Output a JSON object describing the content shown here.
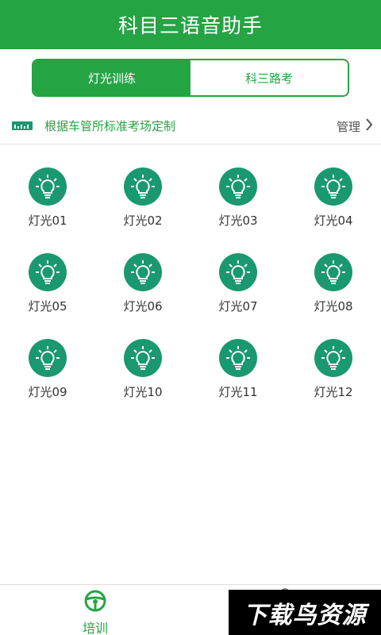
{
  "header": {
    "title": "科目三语音助手"
  },
  "tabs": [
    {
      "label": "灯光训练",
      "active": true
    },
    {
      "label": "科三路考",
      "active": false
    }
  ],
  "notice": {
    "icon": "ruler-icon",
    "text": "根据车管所标准考场定制",
    "manage_label": "管理"
  },
  "lights": [
    {
      "label": "灯光01"
    },
    {
      "label": "灯光02"
    },
    {
      "label": "灯光03"
    },
    {
      "label": "灯光04"
    },
    {
      "label": "灯光05"
    },
    {
      "label": "灯光06"
    },
    {
      "label": "灯光07"
    },
    {
      "label": "灯光08"
    },
    {
      "label": "灯光09"
    },
    {
      "label": "灯光10"
    },
    {
      "label": "灯光11"
    },
    {
      "label": "灯光12"
    }
  ],
  "bottom_nav": {
    "items": [
      {
        "label": "培训",
        "icon": "steering-wheel-icon",
        "active": true
      }
    ]
  },
  "watermark": {
    "text": "下载鸟资源"
  },
  "colors": {
    "primary": "#25a444",
    "bulb_bg": "#1a9870"
  }
}
